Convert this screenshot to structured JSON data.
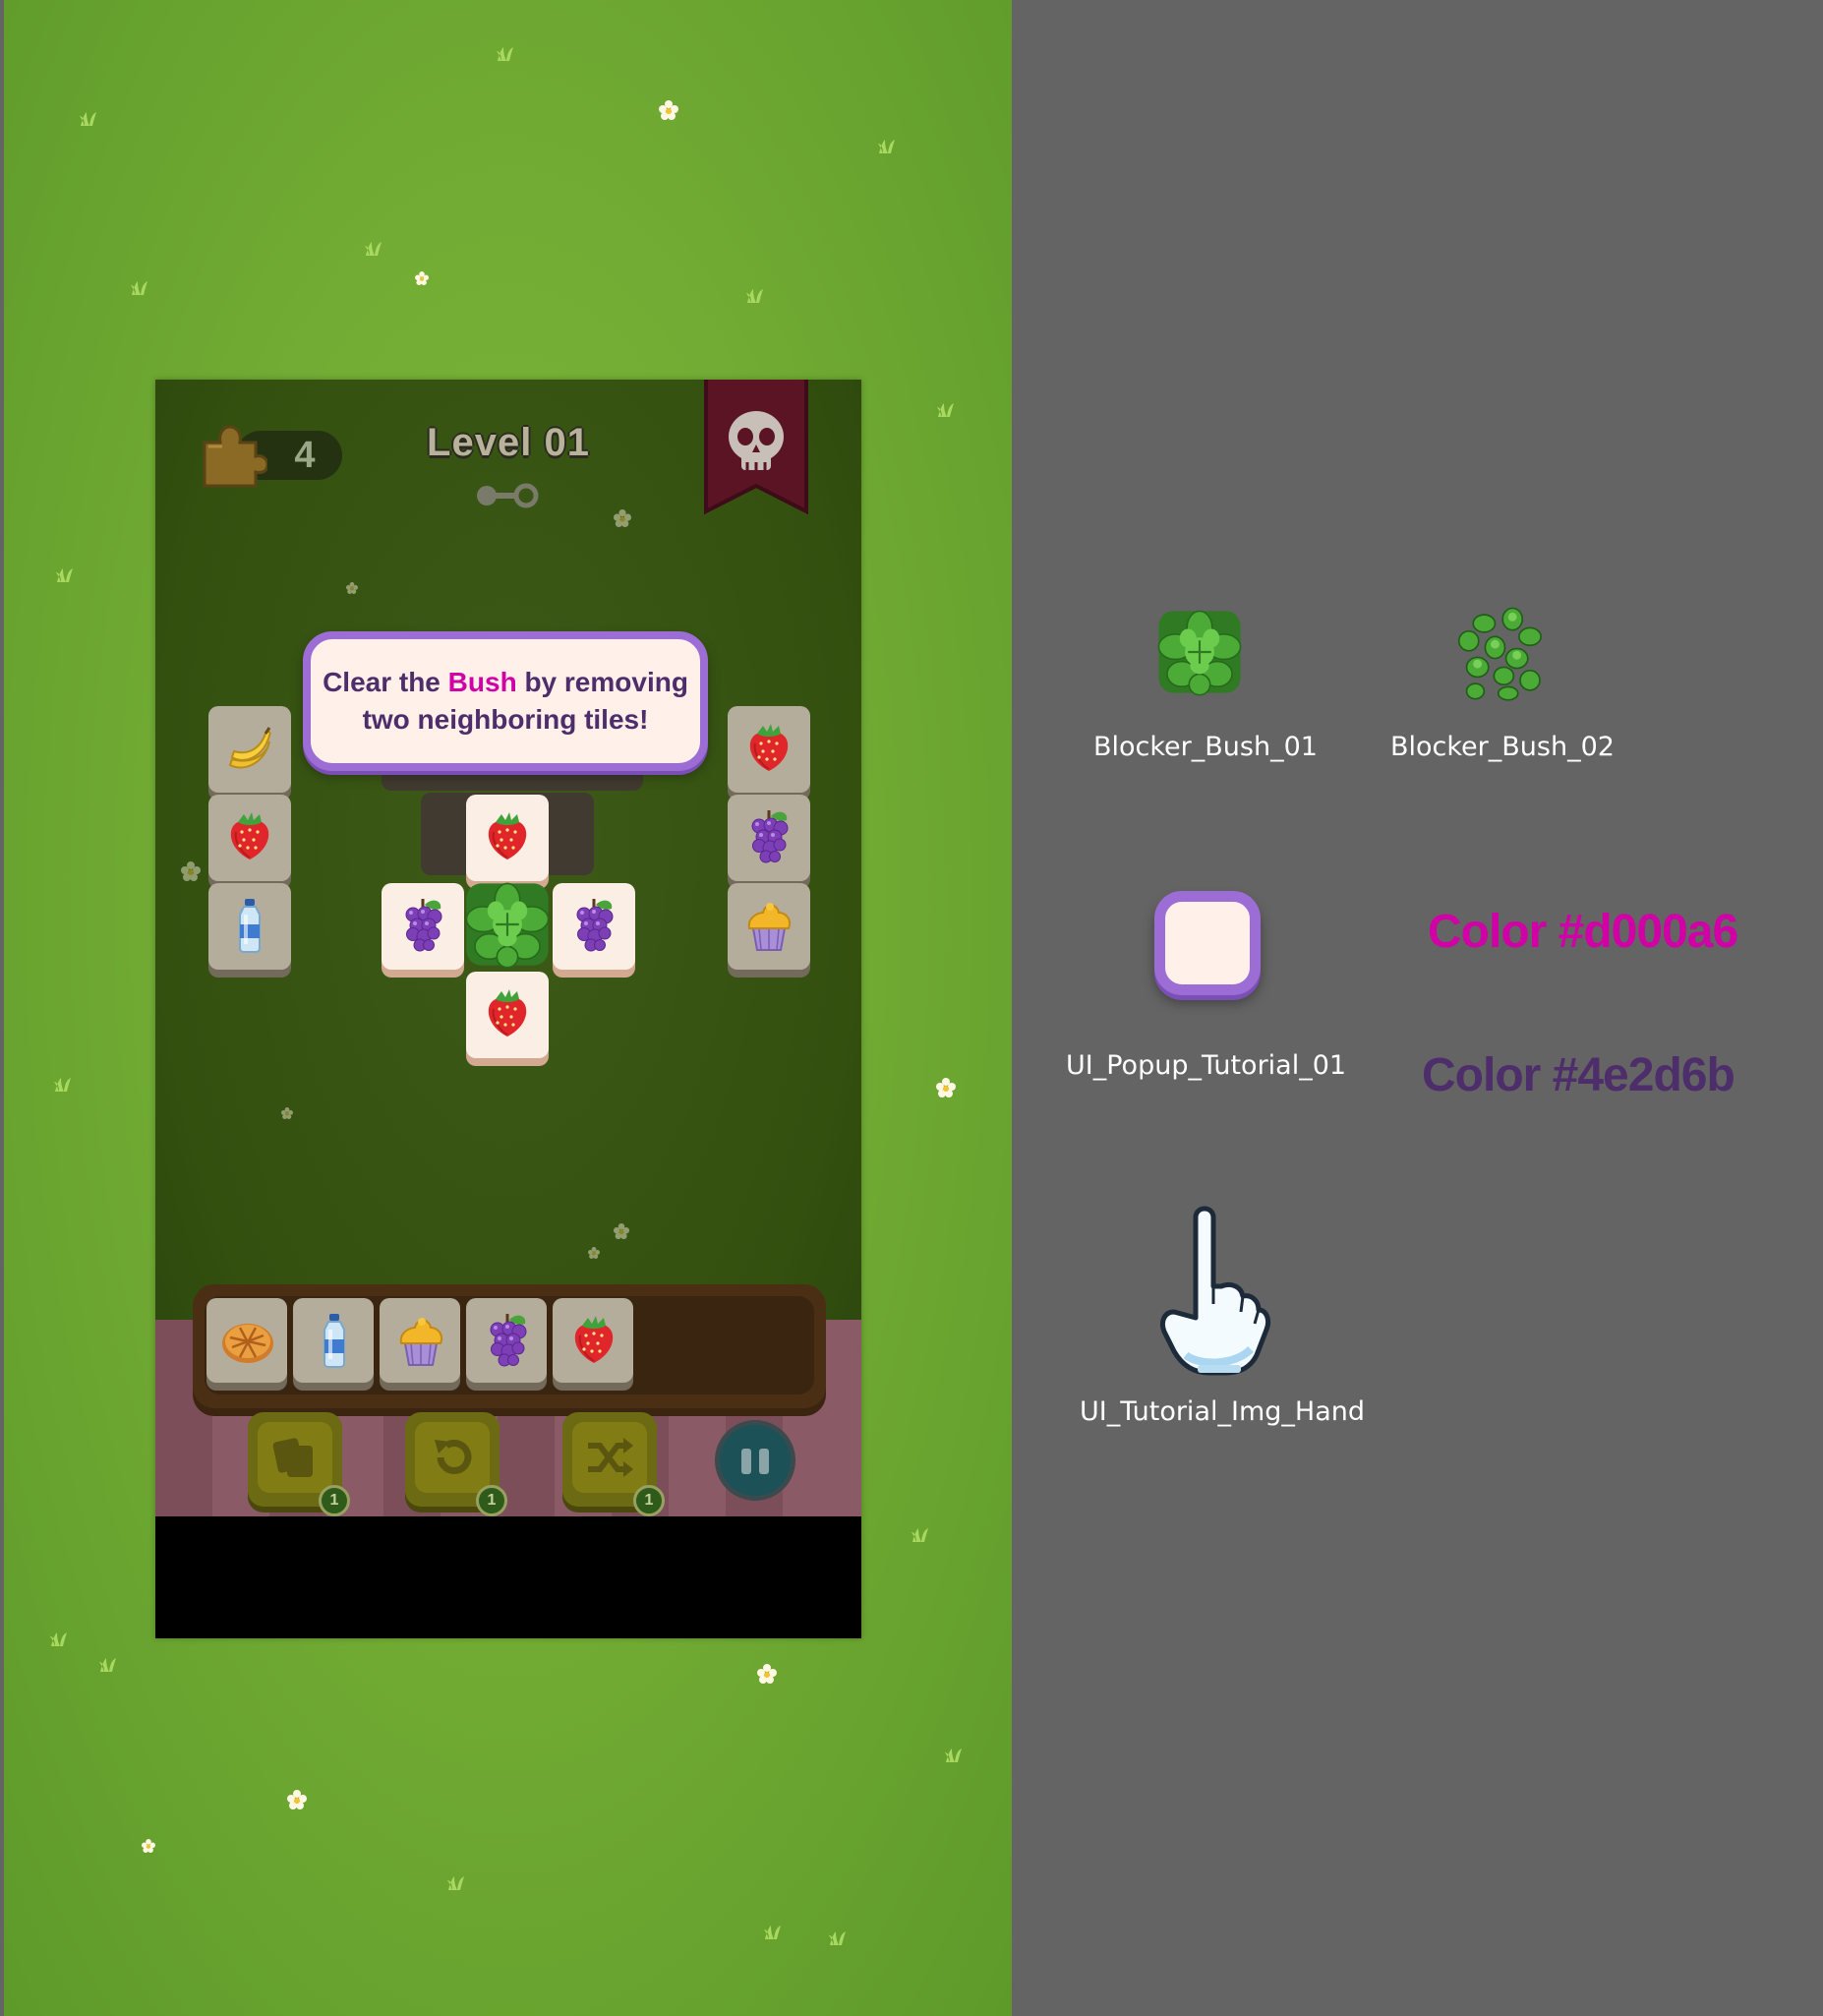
{
  "hud": {
    "puzzle_count": "4",
    "level_title": "Level 01"
  },
  "tutorial_popup": {
    "text_before": "Clear the ",
    "highlight": "Bush",
    "text_after_line1": " by removing",
    "line2": "two neighboring tiles!"
  },
  "board": {
    "left_column": [
      "banana",
      "strawberry",
      "water-bottle"
    ],
    "right_column": [
      "strawberry",
      "grapes",
      "cupcake"
    ],
    "center_top": "strawberry",
    "center_row": [
      "grapes",
      "bush-blocker",
      "grapes"
    ],
    "center_bottom": "strawberry"
  },
  "tray": {
    "items": [
      "pie",
      "water-bottle",
      "cupcake",
      "grapes",
      "strawberry"
    ]
  },
  "boosters": [
    {
      "name": "cards",
      "count": "1"
    },
    {
      "name": "undo",
      "count": "1"
    },
    {
      "name": "shuffle",
      "count": "1"
    }
  ],
  "assets": {
    "bush_01": "Blocker_Bush_01",
    "bush_02": "Blocker_Bush_02",
    "popup": "UI_Popup_Tutorial_01",
    "hand": "UI_Tutorial_Img_Hand",
    "color_1": "Color #d000a6",
    "color_2": "Color #4e2d6b"
  },
  "colors": {
    "highlight": "#d000a6",
    "text": "#4e2d6b",
    "background": "#646464"
  }
}
